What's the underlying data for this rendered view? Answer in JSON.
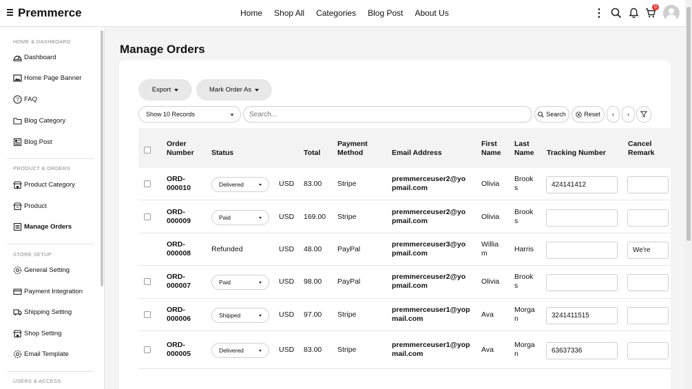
{
  "header": {
    "brand": "Premmerce",
    "nav": [
      "Home",
      "Shop All",
      "Categories",
      "Blog Post",
      "About Us"
    ],
    "cart_count": "0"
  },
  "sidebar": {
    "sections": [
      {
        "title": "HOME & DASHBOARD",
        "items": [
          {
            "label": "Dashboard",
            "icon": "dashboard-icon"
          },
          {
            "label": "Home Page Banner",
            "icon": "image-icon"
          },
          {
            "label": "FAQ",
            "icon": "question-icon"
          },
          {
            "label": "Blog Category",
            "icon": "folder-icon"
          },
          {
            "label": "Blog Post",
            "icon": "newspaper-icon"
          }
        ]
      },
      {
        "title": "PRODUCT & ORDERS",
        "items": [
          {
            "label": "Product Category",
            "icon": "store-icon"
          },
          {
            "label": "Product",
            "icon": "shop-icon"
          },
          {
            "label": "Manage Orders",
            "icon": "orders-icon",
            "active": true
          }
        ]
      },
      {
        "title": "STORE SETUP",
        "items": [
          {
            "label": "General Setting",
            "icon": "gear-icon"
          },
          {
            "label": "Payment Integration",
            "icon": "card-icon"
          },
          {
            "label": "Shipping Setting",
            "icon": "truck-icon"
          },
          {
            "label": "Shop Setting",
            "icon": "store-icon"
          },
          {
            "label": "Email Template",
            "icon": "gear-icon"
          }
        ]
      },
      {
        "title": "USERS & ACCESS",
        "items": []
      }
    ]
  },
  "page": {
    "title": "Manage Orders",
    "export_label": "Export",
    "mark_label": "Mark Order As",
    "records_select": "Show 10 Records",
    "search_placeholder": "Search...",
    "search_btn": "Search",
    "reset_btn": "Reset",
    "prev": "‹",
    "next": "›"
  },
  "table": {
    "headers": {
      "order_number": [
        "Order",
        "Number"
      ],
      "status": "Status",
      "total": "Total",
      "payment_method": [
        "Payment",
        "Method"
      ],
      "email": "Email Address",
      "first_name": [
        "First",
        "Name"
      ],
      "last_name": [
        "Last",
        "Name"
      ],
      "tracking": "Tracking Number",
      "cancel": [
        "Cancel",
        "Remark"
      ]
    },
    "rows": [
      {
        "order": [
          "ORD-",
          "000010"
        ],
        "status": "Delivered",
        "status_select": true,
        "currency": "USD",
        "total": "83.00",
        "method": "Stripe",
        "email": [
          "premmerceuser2@yo",
          "pmail.com"
        ],
        "first": [
          "Olivia"
        ],
        "last": [
          "Brook",
          "s"
        ],
        "tracking": "424141412",
        "remark": ""
      },
      {
        "order": [
          "ORD-",
          "000009"
        ],
        "status": "Paid",
        "status_select": true,
        "currency": "USD",
        "total": "169.00",
        "method": "Stripe",
        "email": [
          "premmerceuser2@yo",
          "pmail.com"
        ],
        "first": [
          "Olivia"
        ],
        "last": [
          "Brook",
          "s"
        ],
        "tracking": "",
        "remark": ""
      },
      {
        "order": [
          "ORD-",
          "000008"
        ],
        "status": "Refunded",
        "status_select": false,
        "currency": "USD",
        "total": "48.00",
        "method": "PayPal",
        "email": [
          "premmerceuser3@yo",
          "pmail.com"
        ],
        "first": [
          "Willia",
          "m"
        ],
        "last": [
          "Harris"
        ],
        "tracking": "",
        "remark": "We're"
      },
      {
        "order": [
          "ORD-",
          "000007"
        ],
        "status": "Paid",
        "status_select": true,
        "currency": "USD",
        "total": "98.00",
        "method": "PayPal",
        "email": [
          "premmerceuser2@yo",
          "pmail.com"
        ],
        "first": [
          "Olivia"
        ],
        "last": [
          "Brook",
          "s"
        ],
        "tracking": "",
        "remark": ""
      },
      {
        "order": [
          "ORD-",
          "000006"
        ],
        "status": "Shipped",
        "status_select": true,
        "currency": "USD",
        "total": "97.00",
        "method": "Stripe",
        "email": [
          "premmerceuser1@yop",
          "mail.com"
        ],
        "first": [
          "Ava"
        ],
        "last": [
          "Morga",
          "n"
        ],
        "tracking": "3241411515",
        "remark": ""
      },
      {
        "order": [
          "ORD-",
          "000005"
        ],
        "status": "Delivered",
        "status_select": true,
        "currency": "USD",
        "total": "83.00",
        "method": "Stripe",
        "email": [
          "premmerceuser1@yop",
          "mail.com"
        ],
        "first": [
          "Ava"
        ],
        "last": [
          "Morga",
          "n"
        ],
        "tracking": "63637336",
        "remark": ""
      }
    ]
  }
}
